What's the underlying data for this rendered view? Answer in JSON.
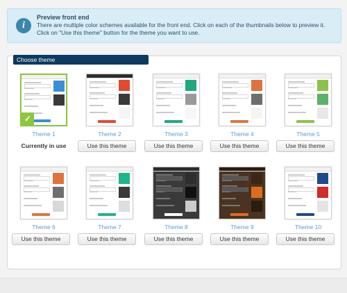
{
  "notice": {
    "title": "Preview front end",
    "body": "There are multiple color schemes available for the front end. Click on each of the thumbnails below to preview it. Click on \"Use this theme\" button for the theme you want to use."
  },
  "panel": {
    "title": "Choose theme"
  },
  "current_label": "Currently in use",
  "button_label": "Use this theme",
  "themes": [
    {
      "label": "Theme 1",
      "header": "#f2f2f2",
      "body": "#ffffff",
      "colors": [
        "#3b8fd9",
        "#3a3a3a",
        "#ffffff"
      ],
      "btn": "#3b8fd9",
      "active": true
    },
    {
      "label": "Theme 2",
      "header": "#2d2d2d",
      "body": "#ffffff",
      "colors": [
        "#e34a2f",
        "#3a3a3a",
        "#f5f5f5"
      ],
      "btn": "#e34a2f",
      "active": false
    },
    {
      "label": "Theme 3",
      "header": "#f2f2f2",
      "body": "#ffffff",
      "colors": [
        "#1fa97a",
        "#9a9a9a",
        "#f7f7f7"
      ],
      "btn": "#1fa97a",
      "active": false
    },
    {
      "label": "Theme 4",
      "header": "#f2f2f2",
      "body": "#ffffff",
      "colors": [
        "#e0733c",
        "#6e6e6e",
        "#f6f4ee"
      ],
      "btn": "#e0733c",
      "active": false
    },
    {
      "label": "Theme 5",
      "header": "#f2f2f2",
      "body": "#ffffff",
      "colors": [
        "#8bc34a",
        "#5bb36a",
        "#e8e8e8"
      ],
      "btn": "#8bc34a",
      "active": false
    },
    {
      "label": "Theme 6",
      "header": "#f2f2f2",
      "body": "#ffffff",
      "colors": [
        "#e0733c",
        "#6e6e6e",
        "#d8d8d8"
      ],
      "btn": "#e0733c",
      "active": false
    },
    {
      "label": "Theme 7",
      "header": "#f2f2f2",
      "body": "#ffffff",
      "colors": [
        "#1fb58a",
        "#3a3a3a",
        "#dddddd"
      ],
      "btn": "#1fb58a",
      "active": false
    },
    {
      "label": "Theme 8",
      "header": "#2b2b2b",
      "body": "#3a3a3a",
      "colors": [
        "#2e2e2e",
        "#111111",
        "#cccccc"
      ],
      "btn": "#ffffff",
      "active": false
    },
    {
      "label": "Theme 9",
      "header": "#2b1c10",
      "body": "#4a3320",
      "colors": [
        "#3a2716",
        "#e06b1f",
        "#2b1c10"
      ],
      "btn": "#e06b1f",
      "active": false
    },
    {
      "label": "Theme 10",
      "header": "#f2f2f2",
      "body": "#ffffff",
      "colors": [
        "#1f4a8f",
        "#d42a2a",
        "#e4e4e4"
      ],
      "btn": "#1f4a8f",
      "active": false
    }
  ]
}
